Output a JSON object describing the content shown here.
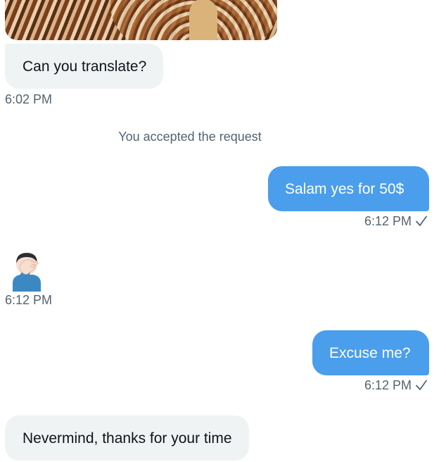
{
  "messages": [
    {
      "type": "image",
      "sender": "other"
    },
    {
      "type": "text",
      "sender": "other",
      "text": "Can you translate?"
    },
    {
      "type": "time",
      "text": "6:02 PM"
    },
    {
      "type": "system",
      "text": "You accepted the request"
    },
    {
      "type": "text",
      "sender": "me",
      "text": "Salam yes for 50$"
    },
    {
      "type": "time",
      "text": "6:12 PM",
      "read_icon": "checkmark-icon"
    },
    {
      "type": "emoji",
      "sender": "other",
      "emoji": "face-palm-emoji"
    },
    {
      "type": "time",
      "text": "6:12 PM"
    },
    {
      "type": "text",
      "sender": "me",
      "text": "Excuse me?"
    },
    {
      "type": "time",
      "text": "6:12 PM",
      "read_icon": "checkmark-icon"
    },
    {
      "type": "text",
      "sender": "other",
      "text": "Nevermind, thanks for your time"
    }
  ],
  "colors": {
    "outgoing_bubble": "#4a9eec",
    "incoming_bubble": "#eff3f4",
    "timestamp": "#536471"
  }
}
